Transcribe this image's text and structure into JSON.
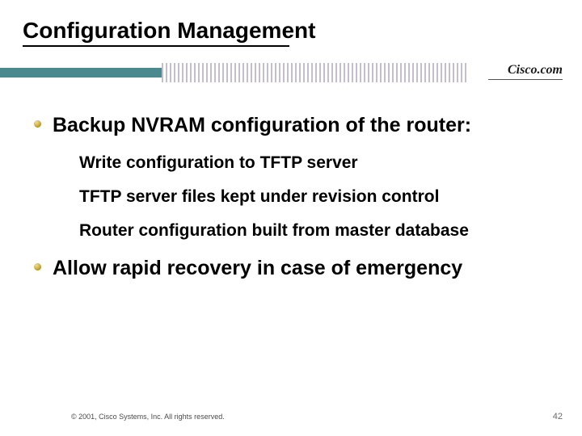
{
  "title": "Configuration Management",
  "logo_text": "Cisco.com",
  "bullets": [
    {
      "text": "Backup NVRAM configuration of the router:",
      "sub": [
        "Write configuration to TFTP server",
        "TFTP server files kept under revision control",
        "Router configuration built from master database"
      ]
    },
    {
      "text": "Allow rapid recovery in case of emergency",
      "sub": []
    }
  ],
  "footer": {
    "copyright": "© 2001, Cisco Systems, Inc. All rights reserved.",
    "page_number": "42"
  }
}
